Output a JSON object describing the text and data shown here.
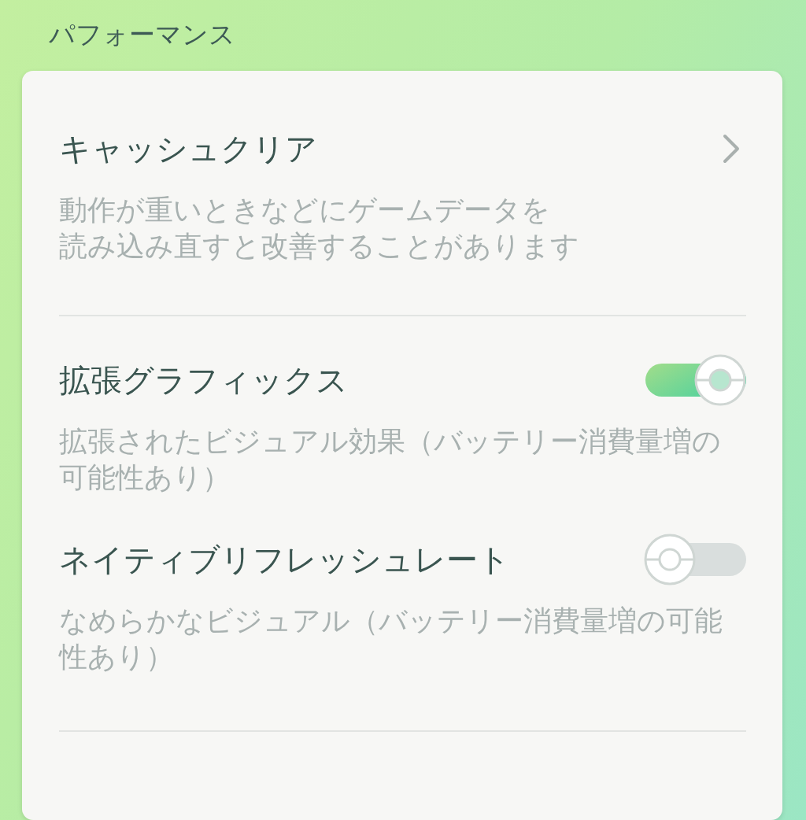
{
  "section_title": "パフォーマンス",
  "items": [
    {
      "kind": "link",
      "title": "キャッシュクリア",
      "description_lines": [
        "動作が重いときなどにゲームデータを",
        "読み込み直すと改善することがあります"
      ]
    },
    {
      "kind": "toggle",
      "title": "拡張グラフィックス",
      "description": "拡張されたビジュアル効果（バッテリー消費量増の可能性あり）",
      "on": true
    },
    {
      "kind": "toggle",
      "title": "ネイティブリフレッシュレート",
      "description": "なめらかなビジュアル（バッテリー消費量増の可能性あり）",
      "on": false
    }
  ]
}
